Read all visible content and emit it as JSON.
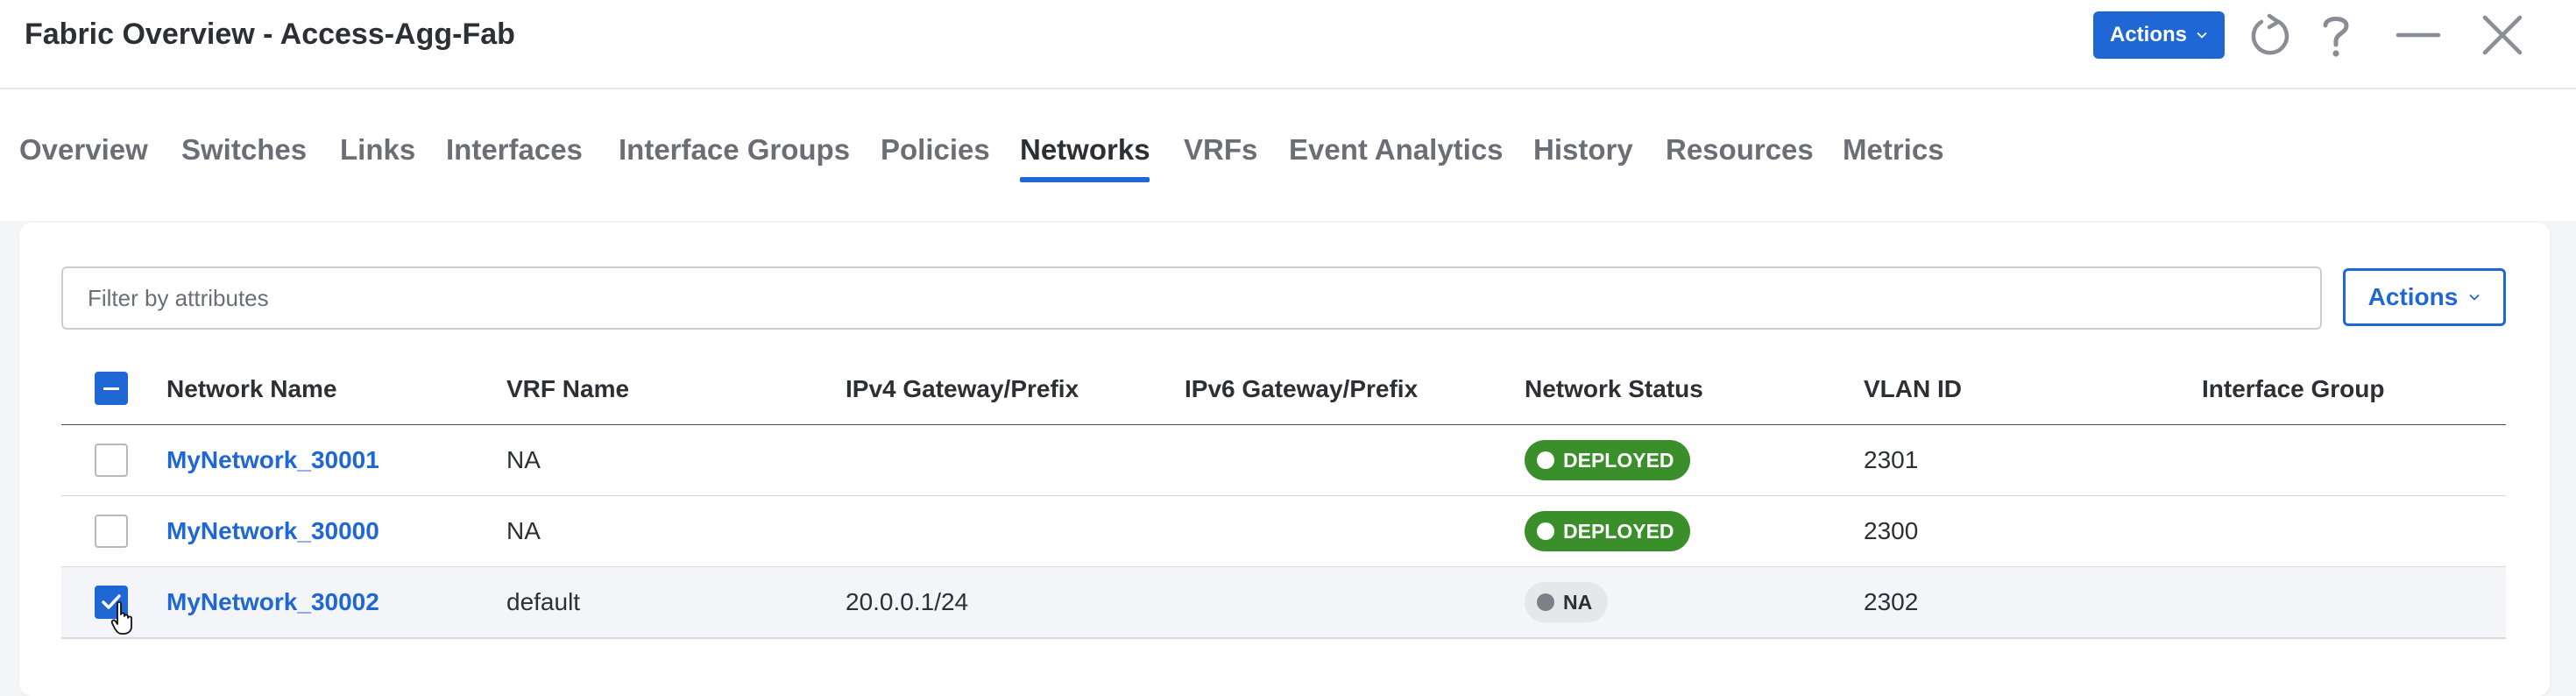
{
  "header": {
    "title": "Fabric Overview - Access-Agg-Fab",
    "actions_label": "Actions"
  },
  "tabs": [
    {
      "label": "Overview"
    },
    {
      "label": "Switches"
    },
    {
      "label": "Links"
    },
    {
      "label": "Interfaces"
    },
    {
      "label": "Interface Groups"
    },
    {
      "label": "Policies"
    },
    {
      "label": "Networks",
      "active": true
    },
    {
      "label": "VRFs"
    },
    {
      "label": "Event Analytics"
    },
    {
      "label": "History"
    },
    {
      "label": "Resources"
    },
    {
      "label": "Metrics"
    }
  ],
  "toolbar": {
    "filter_placeholder": "Filter by attributes",
    "actions_label": "Actions"
  },
  "table": {
    "columns": [
      "Network Name",
      "VRF Name",
      "IPv4 Gateway/Prefix",
      "IPv6 Gateway/Prefix",
      "Network Status",
      "VLAN ID",
      "Interface Group"
    ],
    "rows": [
      {
        "network_name": "MyNetwork_30001",
        "vrf_name": "NA",
        "ipv4": "",
        "ipv6": "",
        "status": "DEPLOYED",
        "vlan_id": "2301",
        "interface_group": "",
        "checked": false
      },
      {
        "network_name": "MyNetwork_30000",
        "vrf_name": "NA",
        "ipv4": "",
        "ipv6": "",
        "status": "DEPLOYED",
        "vlan_id": "2300",
        "interface_group": "",
        "checked": false
      },
      {
        "network_name": "MyNetwork_30002",
        "vrf_name": "default",
        "ipv4": "20.0.0.1/24",
        "ipv6": "",
        "status": "NA",
        "vlan_id": "2302",
        "interface_group": "",
        "checked": true
      }
    ]
  },
  "colors": {
    "accent": "#1f67d4",
    "deployed": "#3a8f2b",
    "na_badge": "#e6e7e9"
  },
  "icons": [
    "chevron-down-icon",
    "refresh-icon",
    "help-icon",
    "minimize-icon",
    "close-icon",
    "checkmark-icon",
    "hand-cursor-icon"
  ]
}
